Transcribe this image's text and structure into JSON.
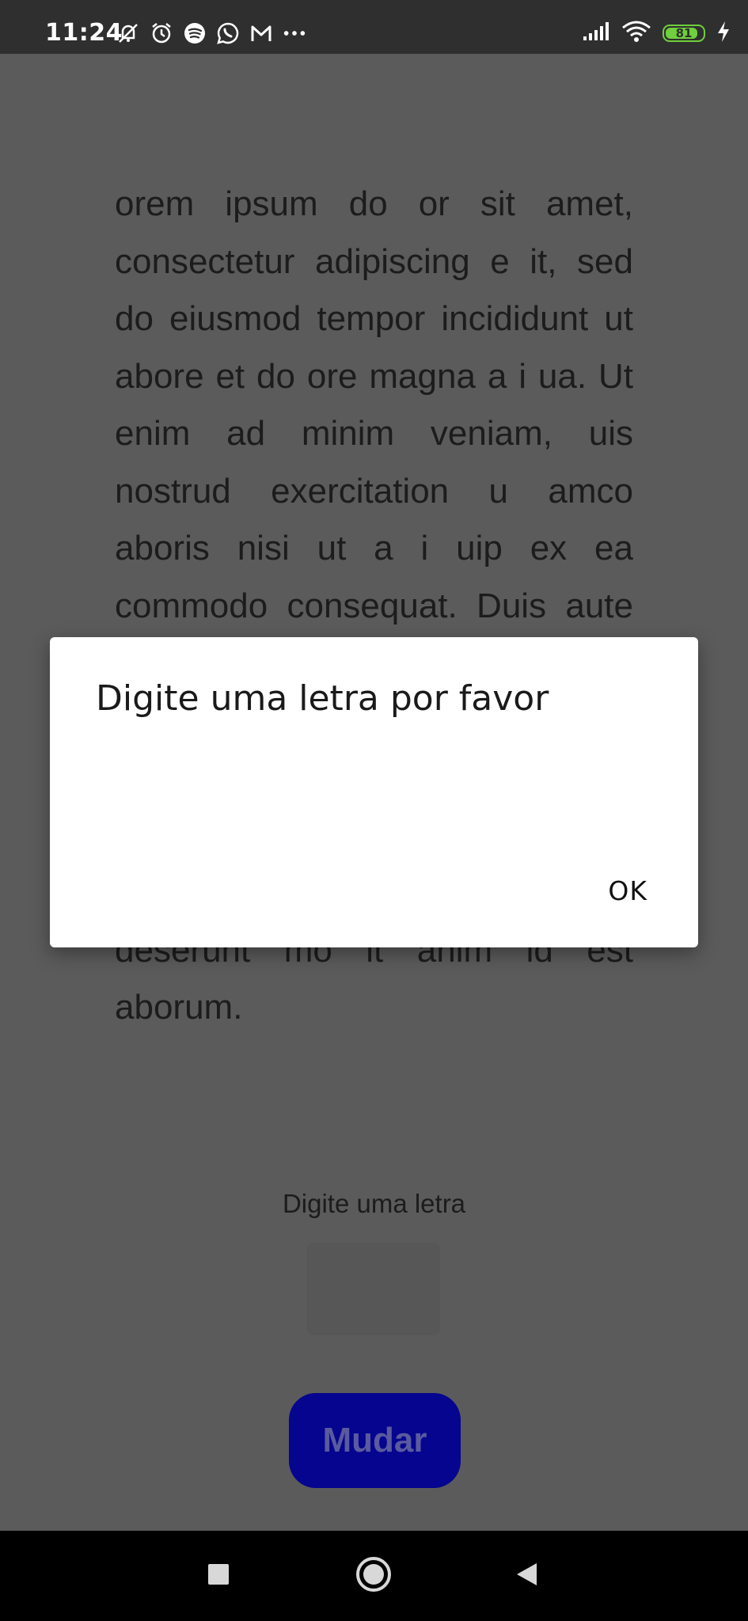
{
  "status_bar": {
    "time": "11:24",
    "left_icons": [
      "mute-bell-icon",
      "alarm-icon",
      "spotify-icon",
      "whatsapp-icon",
      "gmail-icon",
      "more-dots-icon"
    ],
    "right_icons": [
      "signal-icon",
      "wifi-icon",
      "battery-icon",
      "charging-icon"
    ],
    "battery_level": "81",
    "battery_color": "#6fcf3c"
  },
  "content": {
    "paragraph": " orem ipsum do or sit amet, consectetur adipiscing e it, sed do eiusmod tempor incididunt ut abore et do ore magna a i ua. Ut enim ad minim veniam, uis nostrud exercitation u amco aboris nisi ut a i uip ex ea commodo consequat. Duis aute irure do or in reprehenderit in vo uptate ve it esse ci um do ore eu fugiat nu a pariatur. Excepteur sint occaecat cupidatat non proident, sunt in cu pa ui officia deserunt mo it anim id est aborum.",
    "prompt_label": "Digite uma letra",
    "input_value": "",
    "button_label": "Mudar",
    "button_color": "#05058f"
  },
  "dialog": {
    "title": "Digite uma letra por favor",
    "ok_label": "OK"
  },
  "nav_bar": {
    "icons": [
      "recents-square-icon",
      "home-circle-icon",
      "back-triangle-icon"
    ]
  }
}
